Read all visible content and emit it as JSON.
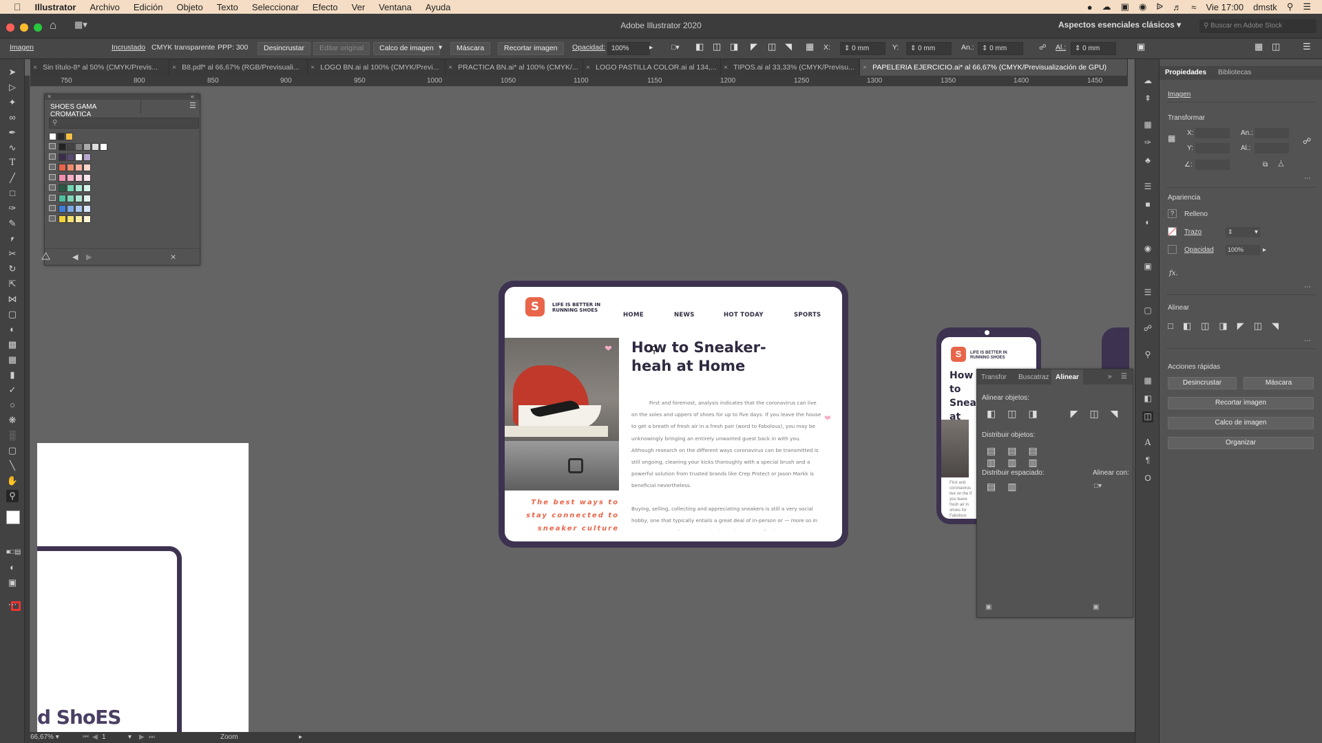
{
  "menubar": {
    "app_name": "Illustrator",
    "items": [
      "Archivo",
      "Edición",
      "Objeto",
      "Texto",
      "Seleccionar",
      "Efecto",
      "Ver",
      "Ventana",
      "Ayuda"
    ],
    "clock": "Vie 17:00",
    "user": "dmstk"
  },
  "window": {
    "title": "Adobe Illustrator 2020",
    "workspace": "Aspectos esenciales clásicos",
    "stock_search_placeholder": "Buscar en Adobe Stock"
  },
  "controlbar": {
    "object_type": "Imagen",
    "embedded": "Incrustado",
    "color_mode": "CMYK transparente",
    "ppp": "PPP: 300",
    "unembed": "Desincrustar",
    "edit_original": "Editar original",
    "image_trace": "Calco de imagen",
    "mask": "Máscara",
    "crop": "Recortar imagen",
    "opacity_label": "Opacidad:",
    "opacity_value": "100%",
    "x_label": "X:",
    "x_value": "0 mm",
    "y_label": "Y:",
    "y_value": "0 mm",
    "w_label": "An.:",
    "w_value": "0 mm",
    "h_label": "Al.:",
    "h_value": "0 mm"
  },
  "tabs": [
    {
      "label": "Sin título-8* al 50% (CMYK/Previs..."
    },
    {
      "label": "B8.pdf* al 66,67% (RGB/Previsuali..."
    },
    {
      "label": "LOGO BN.ai al 100% (CMYK/Previ..."
    },
    {
      "label": "PRACTICA BN.ai* al 100% (CMYK/..."
    },
    {
      "label": "LOGO PASTILLA COLOR.ai al 134,..."
    },
    {
      "label": "TIPOS.ai al 33,33% (CMYK/Previsu..."
    },
    {
      "label": "PAPELERIA EJERCICIO.ai* al 66,67% (CMYK/Previsualización de GPU)"
    }
  ],
  "ruler": {
    "ticks": [
      "750",
      "800",
      "850",
      "900",
      "950",
      "1000",
      "1050",
      "1100",
      "1150",
      "1200",
      "1250",
      "1300",
      "1350",
      "1400",
      "1450"
    ]
  },
  "swatches_panel": {
    "title": "SHOES GAMA CROMATICA",
    "colors": {
      "row1": [
        "#ffffff",
        "#2b2b2b",
        "#f5c048"
      ],
      "row2": [
        "#222222",
        "#444444",
        "#777777",
        "#aaaaaa",
        "#dddddd",
        "#ffffff"
      ],
      "row3": [
        "#3a2e4c",
        "#5a4a72",
        "#ffffff",
        "#b7a6cf"
      ],
      "row4": [
        "#e8654a",
        "#f08a6e",
        "#f7b19d",
        "#fbd6cb"
      ],
      "row5": [
        "#f28fb0",
        "#f6aec6",
        "#f9cddb",
        "#fce6ee"
      ],
      "row6": [
        "#2a5a46",
        "#6fd6b3",
        "#a9e8d2",
        "#d6f5ea"
      ],
      "row7": [
        "#4fbf9f",
        "#7fd6b8",
        "#b0e6d3",
        "#dff5ed"
      ],
      "row8": [
        "#3f7fd6",
        "#7aa9e6",
        "#a9c7f0",
        "#d7e6f8"
      ],
      "row9": [
        "#f2d33a",
        "#f6e072",
        "#f9eba6",
        "#fcf5d6"
      ]
    }
  },
  "artboard": {
    "tagline": "LIFE IS BETTER IN RUNNING SHOES",
    "logo_letter": "S",
    "nav": [
      "HOME",
      "NEWS",
      "HOT TODAY",
      "SPORTS"
    ],
    "headline": "How to Sneaker-heah at Home",
    "body1": "First and foremost, analysis indicates that the coronavirus can live on the soles and uppers of shoes for up to five days. If you leave the house to get a breath of fresh air in a fresh pair (word to Fabolous), you may be unknowingly bringing an entirely unwanted guest back in with you. Although research on the different ways coronavirus can be transmitted is still ongoing, cleaning your kicks thoroughly with a special brush and a powerful solution from trusted brands like Crep Protect or Jason Markk is beneficial nevertheless.",
    "body2": "Buying, selling, collecting and appreciating sneakers is still a very social hobby, one that typically entails a great deal of in-person or — more so in recent years — online communication. When you're firmly",
    "quote": "The best ways to stay connected to sneaker culture",
    "accent_color": "#e8654a",
    "frame_color": "#3d3350"
  },
  "phone_preview": {
    "tagline": "LIFE IS BETTER IN RUNNING SHOES",
    "headline_partial": "How to Snea at Ho",
    "body_partial": "First and coronavirus live on the If you leave fresh air in shoes for Fabolous"
  },
  "left_artboard": {
    "logo_partial": "d ShoES"
  },
  "align_panel": {
    "tabs": [
      "Transfor",
      "Buscatraz",
      "Alinear"
    ],
    "align_objects": "Alinear objetos:",
    "distribute_objects": "Distribuir objetos:",
    "distribute_spacing": "Distribuir espaciado:",
    "align_to": "Alinear con:"
  },
  "properties": {
    "tabs": [
      "Propiedades",
      "Bibliotecas"
    ],
    "section_image": "Imagen",
    "transform": "Transformar",
    "x": "X:",
    "y": "Y:",
    "w": "An.:",
    "h": "Al.:",
    "appearance": "Apariencia",
    "fill": "Relleno",
    "stroke": "Trazo",
    "opacity": "Opacidad",
    "opacity_value": "100%",
    "fx": "fx.",
    "align": "Alinear",
    "quick_actions": "Acciones rápidas",
    "btn_unembed": "Desincrustar",
    "btn_mask": "Máscara",
    "btn_crop": "Recortar imagen",
    "btn_trace": "Calco de imagen",
    "btn_arrange": "Organizar"
  },
  "status": {
    "zoom": "66,67%",
    "page": "1",
    "tool": "Zoom"
  }
}
